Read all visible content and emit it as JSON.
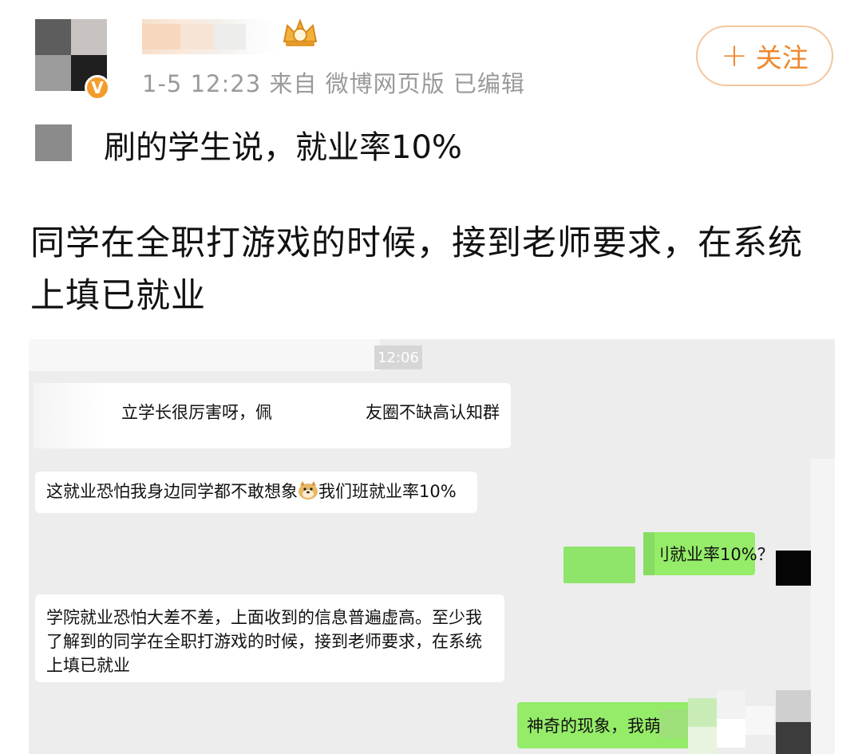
{
  "post": {
    "timestamp": "1-5 12:23",
    "source": "来自 微博网页版",
    "edited": "已编辑",
    "follow_plus": "+",
    "follow_label": "关注",
    "first_line": "刷的学生说，就业率10%",
    "body": "同学在全职打游戏的时候，接到老师要求，在系统上填已就业",
    "verified_badge": "V"
  },
  "chat": {
    "time": "12:06",
    "messages": [
      {
        "side": "left",
        "parts": [
          "立学长很厉害呀，佩",
          "友圈不缺高认知群"
        ]
      },
      {
        "side": "left",
        "before": "这就业恐怕我身边同学都不敢想象",
        "emoji": "doge",
        "after": "我们班就业率10%"
      },
      {
        "side": "right",
        "text": "刂就业率10%？"
      },
      {
        "side": "left",
        "lines": [
          "学院就业恐怕大差不差，上面收到的信息普遍虚高。至少我",
          "了解到的同学在全职打游戏的时候，接到老师要求，在系统",
          "上填已就业"
        ]
      },
      {
        "side": "right",
        "text": "神奇的现象，我萌"
      }
    ]
  },
  "colors": {
    "accent_orange": "#f0872c",
    "follow_border": "#f4c69d",
    "wechat_green": "#95ec69",
    "chat_bg": "#ededed",
    "meta_gray": "#9a9a9a"
  },
  "icons": [
    "verified-icon",
    "vip-crown-icon",
    "doge-emoji-icon",
    "plus-icon"
  ]
}
